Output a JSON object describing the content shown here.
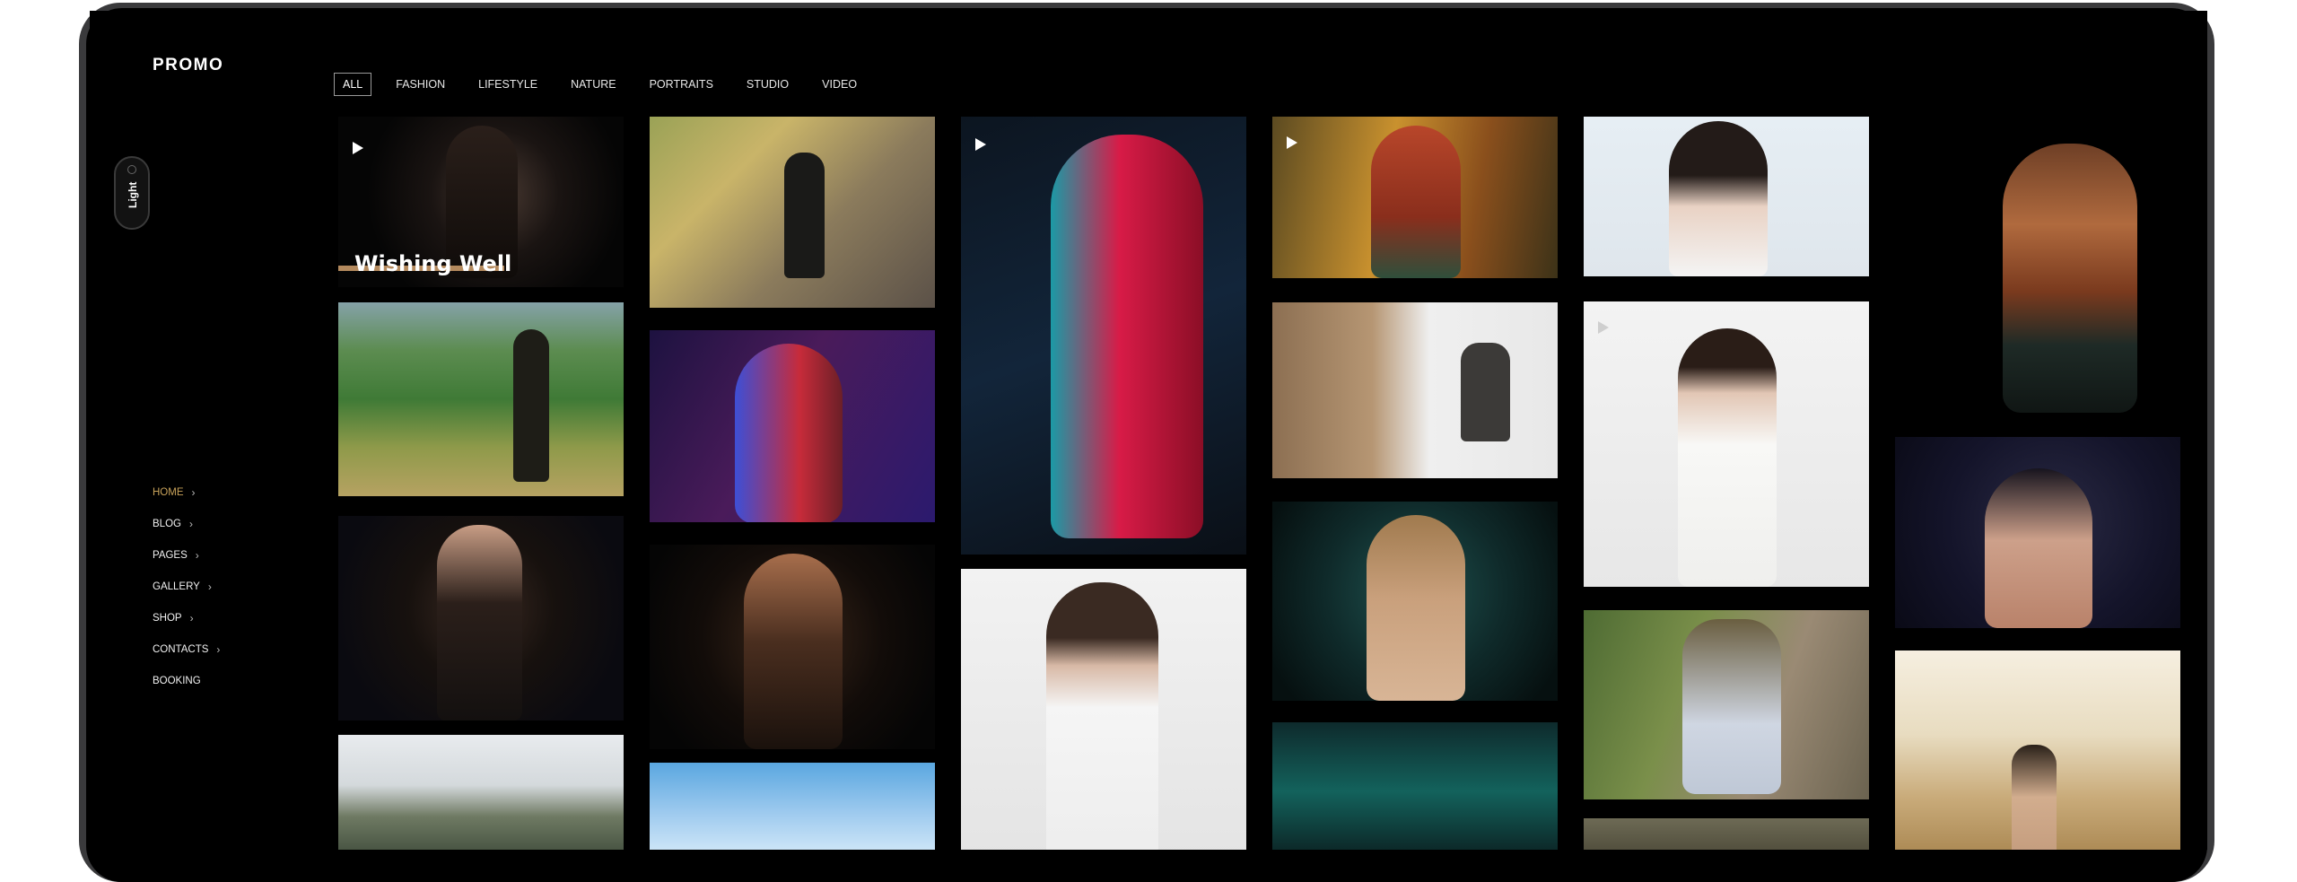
{
  "brand": {
    "logo": "PROMO"
  },
  "filters": [
    "ALL",
    "FASHION",
    "LIFESTYLE",
    "NATURE",
    "PORTRAITS",
    "STUDIO",
    "VIDEO"
  ],
  "active_filter": "ALL",
  "theme_toggle": {
    "label": "Light"
  },
  "nav": [
    {
      "label": "HOME",
      "active": true,
      "has_chevron": true
    },
    {
      "label": "BLOG",
      "active": false,
      "has_chevron": true
    },
    {
      "label": "PAGES",
      "active": false,
      "has_chevron": true
    },
    {
      "label": "GALLERY",
      "active": false,
      "has_chevron": true
    },
    {
      "label": "SHOP",
      "active": false,
      "has_chevron": true
    },
    {
      "label": "CONTACTS",
      "active": false,
      "has_chevron": true
    },
    {
      "label": "BOOKING",
      "active": false,
      "has_chevron": false
    }
  ],
  "gallery": {
    "featured_caption": "Wishing Well"
  },
  "colors": {
    "accent": "#c9a35a",
    "caption_bar": "#b48a5e"
  }
}
